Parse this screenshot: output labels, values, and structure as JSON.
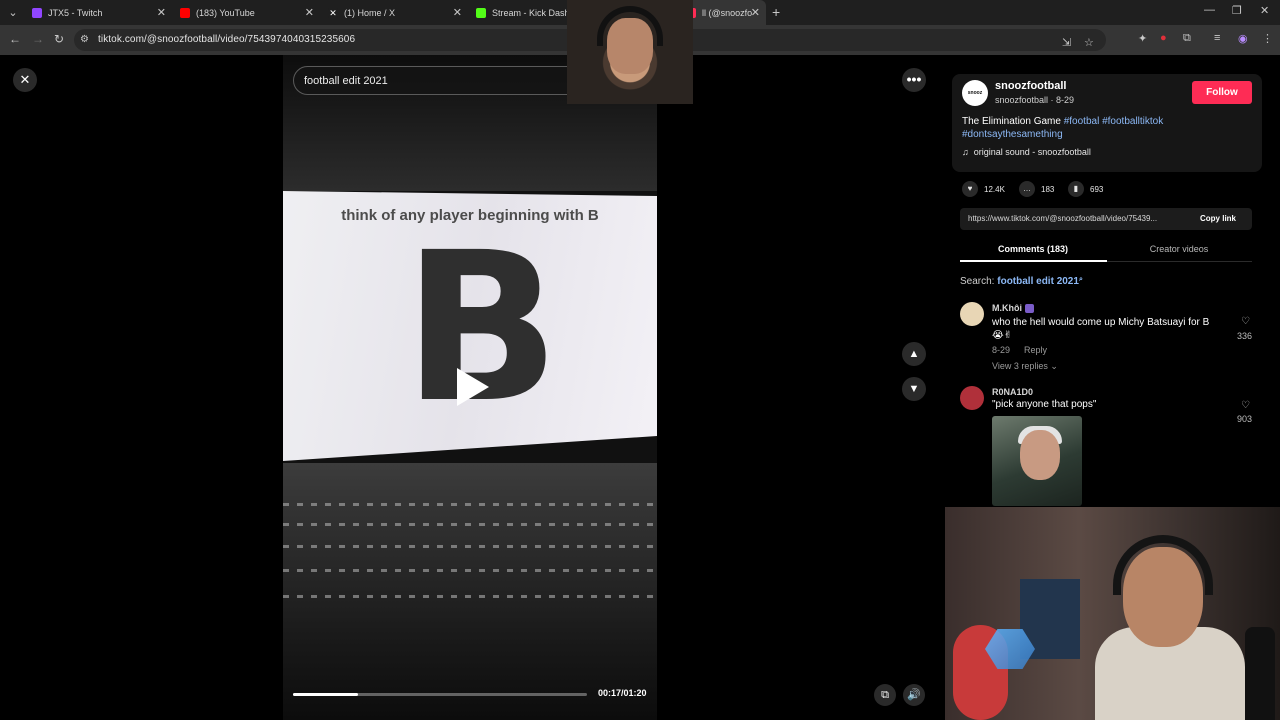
{
  "browser": {
    "tabs": [
      {
        "title": "JTX5 - Twitch",
        "color": "#9146ff"
      },
      {
        "title": "(183) YouTube",
        "color": "#ff0000"
      },
      {
        "title": "(1) Home / X",
        "color": "#e6e6e6"
      },
      {
        "title": "Stream - Kick Dashboard",
        "color": "#53fc18"
      },
      {
        "title": "ll (@snoozfootball)",
        "color": "#fe2c55"
      }
    ],
    "url": "tiktok.com/@snoozfootball/video/7543974040315235606"
  },
  "video": {
    "search_query": "football edit 2021",
    "caption_text": "think of any player beginning with B",
    "big_letter": "B",
    "progress": 0.22,
    "timecode": "00:17/01:20"
  },
  "author": {
    "avatar_text": "snooz",
    "name": "snoozfootball",
    "sub": "snoozfootball · 8-29",
    "follow_label": "Follow",
    "description_plain": "The Elimination Game ",
    "tags": [
      "#footbal",
      "#footballtiktok",
      "#dontsaythesamething"
    ],
    "sound": "original sound - snoozfootball"
  },
  "stats": {
    "likes": "12.4K",
    "comments": "183",
    "saves": "693"
  },
  "share": {
    "link": "https://www.tiktok.com/@snoozfootball/video/75439...",
    "copy_label": "Copy link"
  },
  "tabs": {
    "comments": "Comments (183)",
    "creator": "Creator videos"
  },
  "search_suggest": {
    "prefix": "Search: ",
    "query": "football edit 2021"
  },
  "comments": [
    {
      "user": "M.Khôi",
      "text": "who the hell would come up Michy Batsuayi for B",
      "emoji": "😭✌",
      "date": "8-29",
      "reply_label": "Reply",
      "replies_label": "View 3 replies",
      "likes": "336",
      "avatar_color": "#e8d6b5"
    },
    {
      "user": "R0NA1D0",
      "text": "\"pick anyone that pops\"",
      "likes": "903",
      "avatar_color": "#b0303a"
    }
  ]
}
